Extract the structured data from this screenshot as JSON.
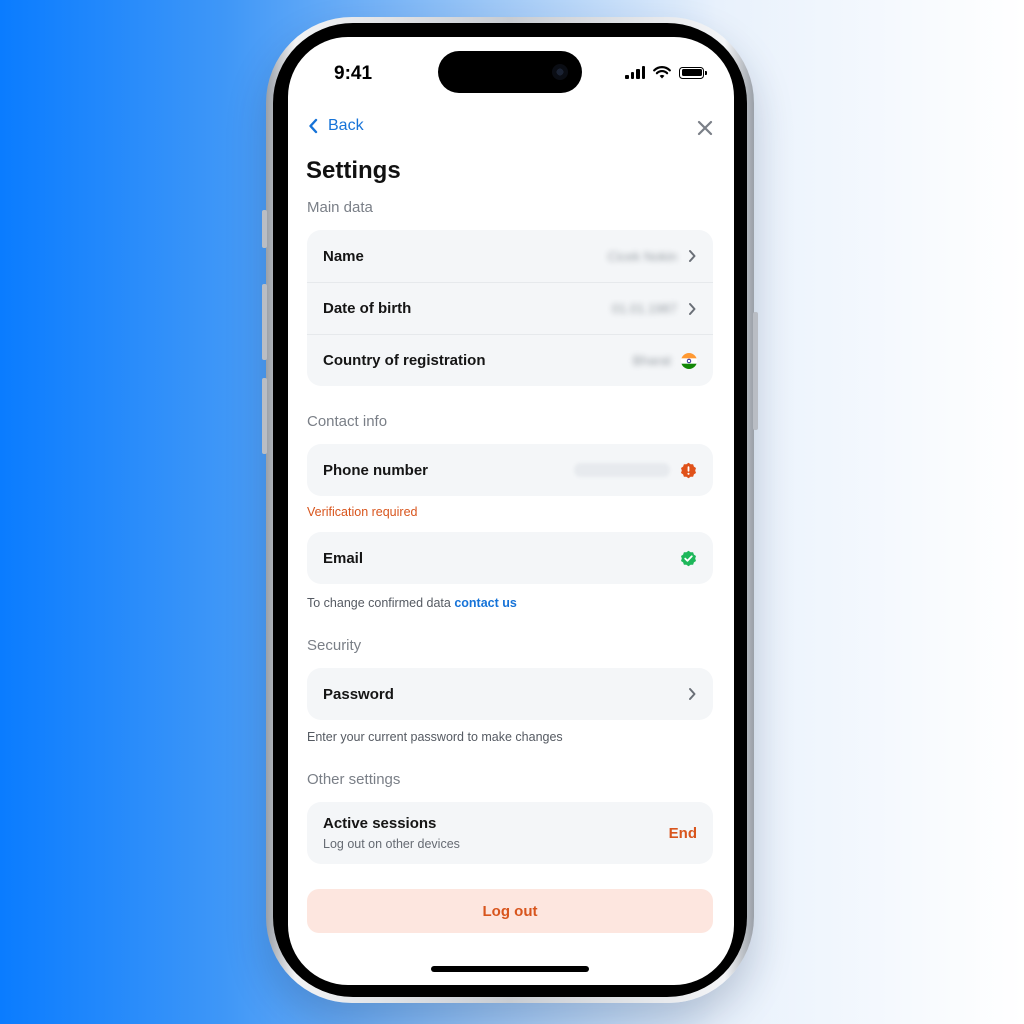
{
  "status_bar": {
    "time": "9:41"
  },
  "nav": {
    "back_label": "Back",
    "back_icon": "chevron-left-icon",
    "close_icon": "close-icon"
  },
  "page": {
    "title": "Settings"
  },
  "sections": {
    "main_data": {
      "label": "Main data",
      "rows": [
        {
          "label": "Name",
          "value": "Cicek Nokin"
        },
        {
          "label": "Date of birth",
          "value": "01.01.1987"
        },
        {
          "label": "Country of registration",
          "value": "Bharat"
        }
      ]
    },
    "contact_info": {
      "label": "Contact info",
      "phone": {
        "label": "Phone number",
        "note": "Verification required"
      },
      "email": {
        "label": "Email"
      },
      "change_note": "To change confirmed data",
      "contact_link": "contact us"
    },
    "security": {
      "label": "Security",
      "password": {
        "label": "Password"
      },
      "note": "Enter your current password to make changes"
    },
    "other_settings": {
      "label": "Other settings",
      "active_sessions": {
        "label": "Active sessions",
        "sub": "Log out on other devices",
        "action": "End"
      }
    }
  },
  "logout": {
    "label": "Log out"
  },
  "colors": {
    "accent": "#1673d8",
    "warning": "#d8551d",
    "success": "#1db75a",
    "card": "#f4f6f8",
    "logout_bg": "#fde6df"
  }
}
